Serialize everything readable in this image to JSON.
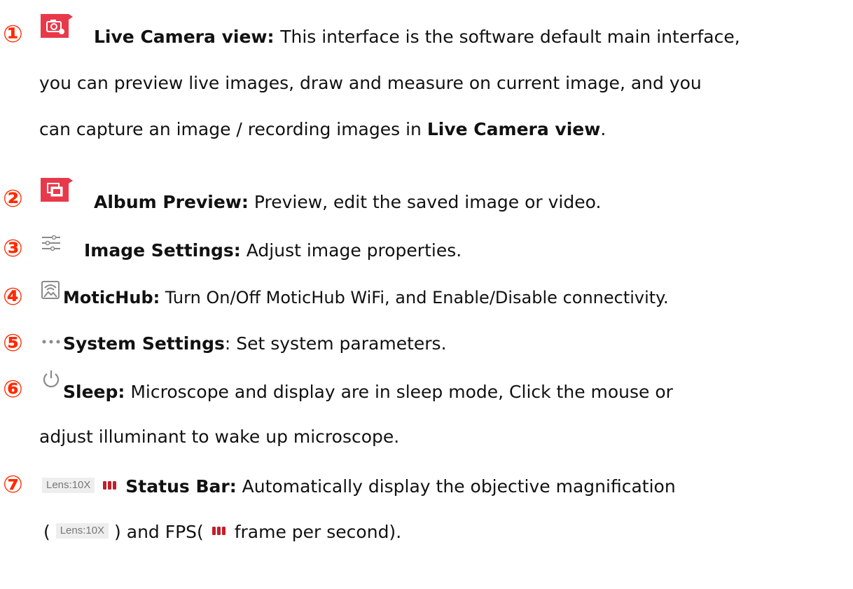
{
  "items": [
    {
      "num": "①",
      "title": "Live Camera view",
      "sep": ": ",
      "lines": [
        "This interface is the software default main interface,",
        "you can preview live images, draw and measure on current image, and you",
        "can capture an image / recording images in "
      ],
      "line3_bold": "Live Camera view",
      "line3_end": ".",
      "icon": "camera-icon"
    },
    {
      "num": "②",
      "title": "Album Preview",
      "sep": ":",
      "text": "  Preview,  edit the saved image or video.",
      "icon": "album-icon"
    },
    {
      "num": "③",
      "title": "Image Settings",
      "sep": ":",
      "text": "  Adjust image properties.",
      "icon": "sliders-icon"
    },
    {
      "num": "④",
      "title": "MoticHub",
      "sep": ":",
      "text": " Turn On/Off MoticHub WiFi, and Enable/Disable connectivity.",
      "icon": "wifi-frame-icon"
    },
    {
      "num": "⑤",
      "title": "System Settings",
      "text": ": Set system parameters.",
      "icon": "more-dots-icon"
    },
    {
      "num": "⑥",
      "title": "Sleep:",
      "lines": [
        " Microscope and display are in sleep mode, Click the mouse or",
        "adjust illuminant to wake up microscope."
      ],
      "icon": "power-icon"
    },
    {
      "num": "⑦",
      "title": "Status Bar:",
      "lines": [
        " Automatically display the objective magnification",
        ") and FPS(",
        "frame per second)."
      ],
      "line2_open": "( ",
      "lens_label": "Lens:10X",
      "icon": "fps-bars-icon"
    }
  ],
  "colors": {
    "accent": "#ff2a00",
    "icon_red": "#e8394a",
    "icon_gray": "#8a8a8a"
  }
}
